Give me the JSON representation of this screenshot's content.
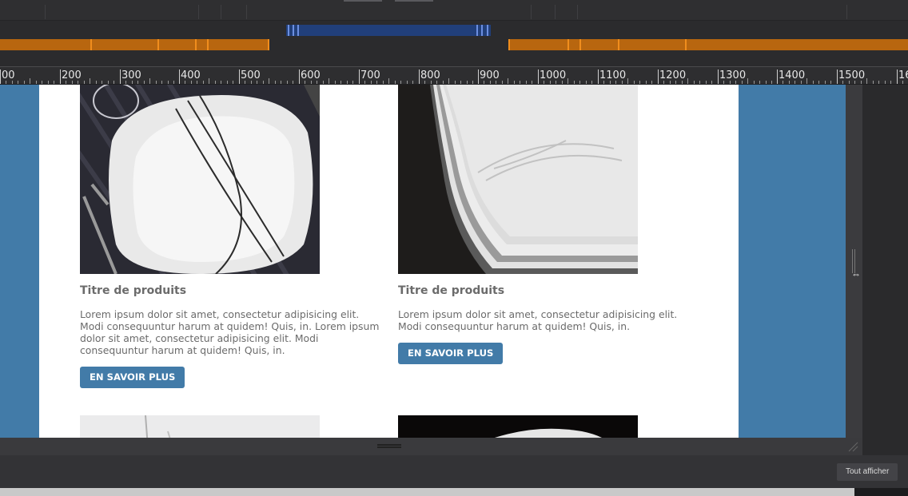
{
  "ruler": {
    "labels": [
      "00",
      "200",
      "300",
      "400",
      "500",
      "600",
      "700",
      "800",
      "900",
      "1000",
      "1100",
      "1200",
      "1300",
      "1400",
      "1500",
      "160"
    ]
  },
  "cards": [
    {
      "title": "Titre de produits",
      "text": "Lorem ipsum dolor sit amet, consectetur adipisicing elit. Modi consequuntur harum at quidem! Quis, in. Lorem ipsum dolor sit amet, consectetur adipisicing elit. Modi consequuntur harum at quidem! Quis, in.",
      "button": "EN SAVOIR PLUS"
    },
    {
      "title": "Titre de produits",
      "text": "Lorem ipsum dolor sit amet, consectetur adipisicing elit. Modi consequuntur harum at quidem! Quis, in.",
      "button": "EN SAVOIR PLUS"
    }
  ],
  "bottom": {
    "show_all": "Tout afficher"
  },
  "colors": {
    "canvas_bg": "#427ba8",
    "breakpoint_orange": "#b8660f",
    "breakpoint_blue": "#213f7a",
    "button_bg": "#427ba8"
  }
}
